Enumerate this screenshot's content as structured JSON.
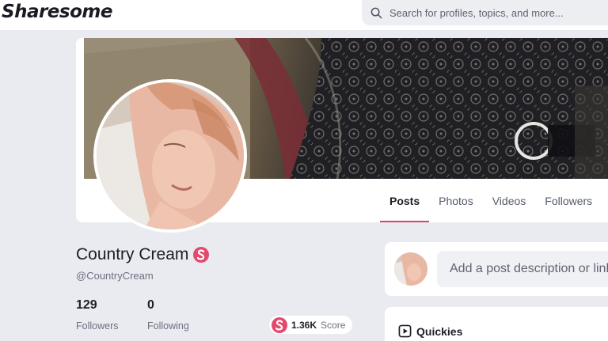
{
  "header": {
    "logo": "Sharesome",
    "search_placeholder": "Search for profiles, topics, and more..."
  },
  "tabs": [
    {
      "label": "Posts",
      "active": true
    },
    {
      "label": "Photos",
      "active": false
    },
    {
      "label": "Videos",
      "active": false
    },
    {
      "label": "Followers",
      "active": false
    }
  ],
  "profile": {
    "display_name": "Country Cream",
    "handle": "@CountryCream",
    "followers_count": "129",
    "followers_label": "Followers",
    "following_count": "0",
    "following_label": "Following",
    "score_value": "1.36K",
    "score_label": "Score"
  },
  "composer": {
    "placeholder": "Add a post description or link"
  },
  "quickies": {
    "title": "Quickies"
  },
  "colors": {
    "accent": "#e24a6e",
    "page_background": "#e9ebf0",
    "card_background": "#ffffff"
  },
  "icons": [
    "search-icon",
    "verified-badge-icon",
    "score-icon",
    "quickies-play-icon"
  ]
}
